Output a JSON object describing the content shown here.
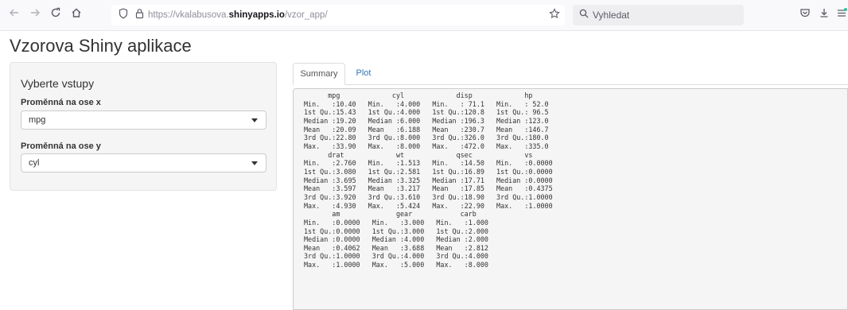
{
  "browser": {
    "url_host_prefix": "https://vkalabusova.",
    "url_host_bold": "shinyapps.io",
    "url_path": "/vzor_app/",
    "search_placeholder": "Vyhledat"
  },
  "app": {
    "title": "Vzorova Shiny aplikace"
  },
  "sidebar": {
    "heading": "Vyberte vstupy",
    "x_label": "Proměnná na ose x",
    "x_value": "mpg",
    "y_label": "Proměnná na ose y",
    "y_value": "cyl"
  },
  "tabs": {
    "summary": "Summary",
    "plot": "Plot"
  },
  "summary_output": "      mpg             cyl             disp             hp       \nMin.   :10.40   Min.   :4.000   Min.   : 71.1   Min.   : 52.0  \n1st Qu.:15.43   1st Qu.:4.000   1st Qu.:120.8   1st Qu.: 96.5  \nMedian :19.20   Median :6.000   Median :196.3   Median :123.0  \nMean   :20.09   Mean   :6.188   Mean   :230.7   Mean   :146.7  \n3rd Qu.:22.80   3rd Qu.:8.000   3rd Qu.:326.0   3rd Qu.:180.0  \nMax.   :33.90   Max.   :8.000   Max.   :472.0   Max.   :335.0  \n      drat             wt             qsec             vs        \nMin.   :2.760   Min.   :1.513   Min.   :14.50   Min.   :0.0000  \n1st Qu.:3.080   1st Qu.:2.581   1st Qu.:16.89   1st Qu.:0.0000  \nMedian :3.695   Median :3.325   Median :17.71   Median :0.0000  \nMean   :3.597   Mean   :3.217   Mean   :17.85   Mean   :0.4375  \n3rd Qu.:3.920   3rd Qu.:3.610   3rd Qu.:18.90   3rd Qu.:1.0000  \nMax.   :4.930   Max.   :5.424   Max.   :22.90   Max.   :1.0000  \n       am              gear            carb      \nMin.   :0.0000   Min.   :3.000   Min.   :1.000  \n1st Qu.:0.0000   1st Qu.:3.000   1st Qu.:2.000  \nMedian :0.0000   Median :4.000   Median :2.000  \nMean   :0.4062   Mean   :3.688   Mean   :2.812  \n3rd Qu.:1.0000   3rd Qu.:4.000   3rd Qu.:4.000  \nMax.   :1.0000   Max.   :5.000   Max.   :8.000  ",
  "icons": {
    "back": "back-arrow-icon",
    "forward": "forward-arrow-icon",
    "reload": "reload-icon",
    "home": "home-icon",
    "shield": "shield-icon",
    "lock": "lock-icon",
    "bookmark": "star-bookmark-icon",
    "search": "search-icon",
    "pocket": "pocket-icon",
    "download": "download-icon",
    "menu": "menu-icon"
  }
}
